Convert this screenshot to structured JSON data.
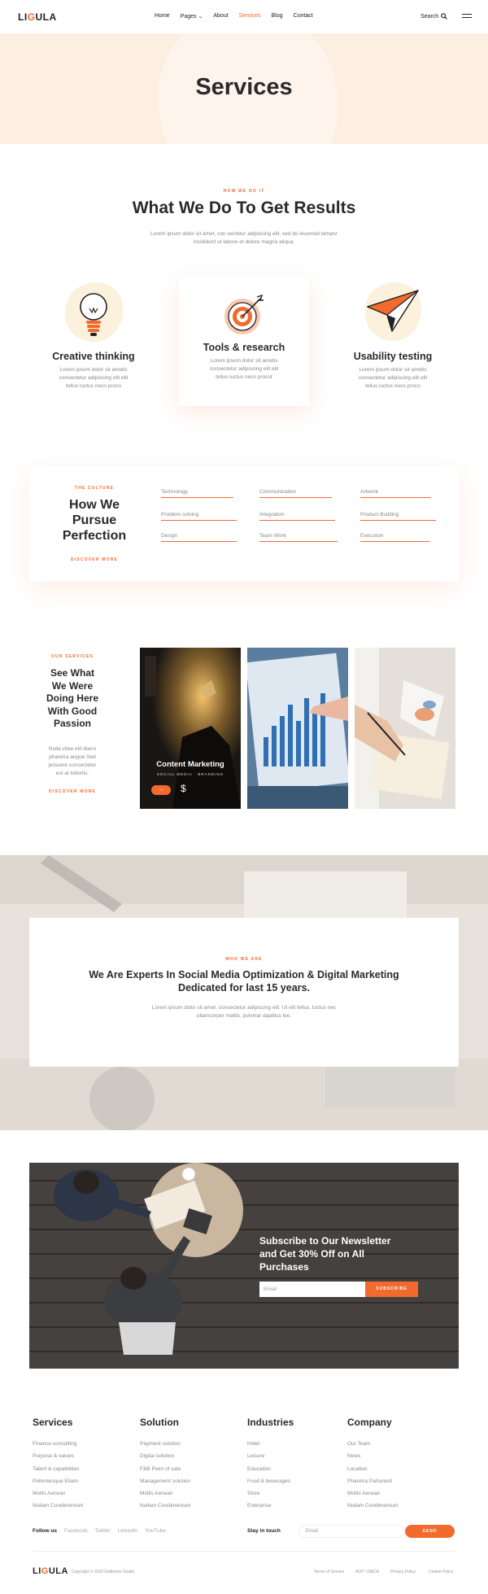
{
  "brand": {
    "logo_prefix": "LI",
    "logo_accent": "G",
    "logo_suffix": "ULA",
    "accent_color": "#f26a2e"
  },
  "nav": {
    "items": [
      "Home",
      "Pages",
      "About",
      "Services",
      "Blog",
      "Contact"
    ],
    "active": "Services",
    "search_label": "Search"
  },
  "hero": {
    "title": "Services"
  },
  "results": {
    "kicker": "HOW WE DO IT",
    "title": "What We Do To Get Results",
    "text_1": "Lorem ipsum dolor sit amet, con sectetur adipiscing elit, sed do eiusmod tempor",
    "text_2": "incididunt ut labore et dolore magna aliqua."
  },
  "services": [
    {
      "title": "Creative thinking",
      "icon": "lightbulb-icon",
      "text_1": "Lorem ipsum dolor sit ametis",
      "text_2": "consectetur adipiscing elit elit",
      "text_3": "tellus luctus neco proco"
    },
    {
      "title": "Tools & research",
      "icon": "target-icon",
      "text_1": "Lorem ipsum dolor sit ametis",
      "text_2": "consectetur adipiscing elit elit",
      "text_3": "tellus luctus neco procot"
    },
    {
      "title": "Usability testing",
      "icon": "paper-plane-icon",
      "text_1": "Lorem ipsum dolor sit ametis",
      "text_2": "consectetur adipiscing elit elit",
      "text_3": "tellus luctus neco proco"
    }
  ],
  "culture": {
    "kicker": "THE CULTURE",
    "title_1": "How We",
    "title_2": "Pursue",
    "title_3": "Perfection",
    "link": "DISCOVER MORE",
    "tags": [
      "Technology",
      "Communication",
      "Artwork",
      "Problem solving",
      "Integration",
      "Product Building",
      "Design",
      "Team Work",
      "Execution"
    ]
  },
  "what_we_do": {
    "kicker": "OUR SERVICES",
    "title_1": "See What",
    "title_2": "We Were",
    "title_3": "Doing Here",
    "title_4": "With Good",
    "title_5": "Passion",
    "text_1": "Nulla vitae elit libero",
    "text_2": "pharetra augue Sed",
    "text_3": "posuere consectetur",
    "text_4": "est at lobortis.",
    "link": "DISCOVER MORE",
    "card_title": "Content Marketing",
    "card_tags": "SOCIAL MEDIA · BRANDING",
    "card_arrow": "→",
    "card_currency": "$"
  },
  "experts": {
    "kicker": "WHO WE ARE",
    "title_1": "We Are Experts In Social Media Optimization & Digital Marketing",
    "title_2": "Dedicated for last 15 years.",
    "text_1": "Lorem ipsum dolor sit amet, consectetur adipiscing elit. Ut elit tellus, luctus nec",
    "text_2": "ullamcorper mattis, pulvinar dapibus leo."
  },
  "newsletter": {
    "title_1": "Subscribe to Our Newsletter",
    "title_2": "and Get 30% Off on All",
    "title_3": "Purchases",
    "placeholder": "Email",
    "button": "SUBSCRIBE"
  },
  "footer": {
    "columns": [
      {
        "title": "Services",
        "items": [
          "Finance consulting",
          "Purpose & values",
          "Talent & capabilities",
          "Pellentesque Etiam",
          "Mollis Aenean",
          "Nullam Condimentum"
        ]
      },
      {
        "title": "Solution",
        "items": [
          "Payment solution",
          "Digital solution",
          "F&B Point of sale",
          "Management solution",
          "Mollis Aenean",
          "Nullam Condimentum"
        ]
      },
      {
        "title": "Industries",
        "items": [
          "Hotel",
          "Leisure",
          "Education",
          "Food & beverages",
          "Store",
          "Enterprise"
        ]
      },
      {
        "title": "Company",
        "items": [
          "Our Team",
          "News",
          "Location",
          "Pharetra Parturient",
          "Mollis Aenean",
          "Nullam Condimentum"
        ]
      }
    ],
    "follow_label": "Follow us",
    "social": [
      "Facebook",
      "Twitter",
      "LinkedIn",
      "YouTube"
    ],
    "stay_label": "Stay in touch",
    "email_placeholder": "Email",
    "send_button": "SEND",
    "copyright": "Copyright © 2020 Deltheme Studio",
    "legal": [
      "Terms of Service",
      "ADP / DMCA",
      "Privacy Policy",
      "Cookie Policy"
    ]
  }
}
